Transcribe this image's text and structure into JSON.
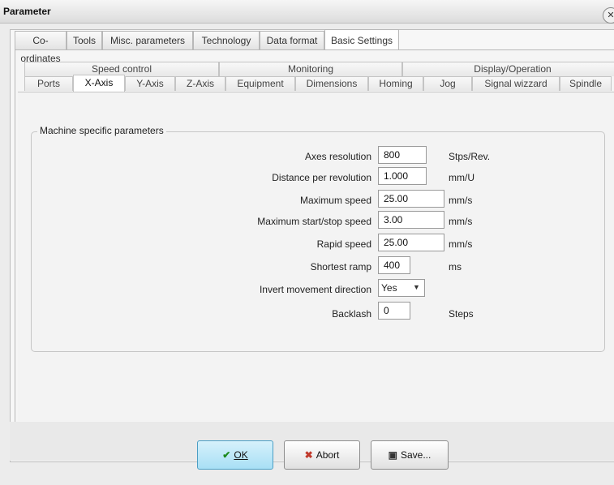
{
  "window": {
    "title": "Parameter",
    "close_icon": "close-icon"
  },
  "tabs_level1": [
    "Co-ordinates",
    "Tools",
    "Misc. parameters",
    "Technology",
    "Data format",
    "Basic Settings"
  ],
  "tabs_row_a": [
    "Speed control",
    "Monitoring",
    "Display/Operation"
  ],
  "tabs_row_b": [
    "Ports",
    "X-Axis",
    "Y-Axis",
    "Z-Axis",
    "Equipment",
    "Dimensions",
    "Homing",
    "Jog",
    "Signal wizzard",
    "Spindle"
  ],
  "group": {
    "legend": "Machine specific parameters"
  },
  "params": [
    {
      "label": "Axes resolution",
      "value": "800",
      "unit": "Stps/Rev."
    },
    {
      "label": "Distance per revolution",
      "value": "1.000",
      "unit": "mm/U"
    },
    {
      "label": "Maximum speed",
      "value": "25.00",
      "unit": "mm/s"
    },
    {
      "label": "Maximum start/stop speed",
      "value": "3.00",
      "unit": "mm/s"
    },
    {
      "label": "Rapid speed",
      "value": "25.00",
      "unit": "mm/s"
    },
    {
      "label": "Shortest ramp",
      "value": "400",
      "unit": "ms"
    },
    {
      "label": "Invert movement direction",
      "value": "Yes",
      "unit": ""
    },
    {
      "label": "Backlash",
      "value": "0",
      "unit": "Steps"
    }
  ],
  "buttons": {
    "ok": {
      "label": "OK",
      "icon": "checkmark-icon"
    },
    "abort": {
      "label": "Abort",
      "icon": "x-icon"
    },
    "save": {
      "label": "Save...",
      "icon": "floppy-disk-icon"
    }
  },
  "colors": {
    "ok_accent": "#a8dff5",
    "abort_icon": "#c0392b",
    "ok_icon": "#1e8a1e"
  }
}
